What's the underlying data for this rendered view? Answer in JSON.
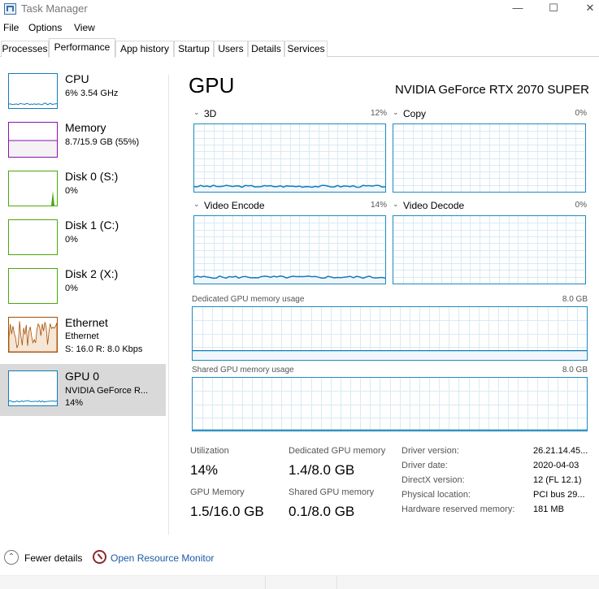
{
  "window": {
    "title": "Task Manager",
    "min_glyph": "—",
    "max_glyph": "☐",
    "close_glyph": "✕"
  },
  "menu": [
    "File",
    "Options",
    "View"
  ],
  "tabs": [
    "Processes",
    "Performance",
    "App history",
    "Startup",
    "Users",
    "Details",
    "Services"
  ],
  "active_tab": "Performance",
  "sidebar": [
    {
      "title": "CPU",
      "sub1": "6%  3.54 GHz",
      "sub2": "",
      "color": "#117dbb"
    },
    {
      "title": "Memory",
      "sub1": "8.7/15.9 GB (55%)",
      "sub2": "",
      "color": "#8b12ae"
    },
    {
      "title": "Disk 0 (S:)",
      "sub1": "0%",
      "sub2": "",
      "color": "#4da60c"
    },
    {
      "title": "Disk 1 (C:)",
      "sub1": "0%",
      "sub2": "",
      "color": "#4da60c"
    },
    {
      "title": "Disk 2 (X:)",
      "sub1": "0%",
      "sub2": "",
      "color": "#4da60c"
    },
    {
      "title": "Ethernet",
      "sub1": "Ethernet",
      "sub2": "S: 16.0  R: 8.0 Kbps",
      "color": "#a74f01"
    },
    {
      "title": "GPU 0",
      "sub1": "NVIDIA GeForce R...",
      "sub2": "14%",
      "color": "#117dbb"
    }
  ],
  "selected_item": "GPU 0",
  "gpu": {
    "title": "GPU",
    "model": "NVIDIA GeForce RTX 2070 SUPER",
    "engines": [
      {
        "name": "3D",
        "percent": "12%",
        "level": 0.12
      },
      {
        "name": "Copy",
        "percent": "0%",
        "level": 0
      },
      {
        "name": "Video Encode",
        "percent": "14%",
        "level": 0.14
      },
      {
        "name": "Video Decode",
        "percent": "0%",
        "level": 0
      }
    ],
    "chevron_glyph": "⌄",
    "dedicated_memory_usage": {
      "label": "Dedicated GPU memory usage",
      "max": "8.0 GB",
      "level": 0.175
    },
    "shared_memory_usage": {
      "label": "Shared GPU memory usage",
      "max": "8.0 GB",
      "level": 0.0125
    }
  },
  "stats": {
    "utilization": {
      "label": "Utilization",
      "value": "14%"
    },
    "dedicated_memory": {
      "label": "Dedicated GPU memory",
      "value": "1.4/8.0 GB"
    },
    "gpu_memory": {
      "label": "GPU Memory",
      "value": "1.5/16.0 GB"
    },
    "shared_memory": {
      "label": "Shared GPU memory",
      "value": "0.1/8.0 GB"
    }
  },
  "details": [
    {
      "label": "Driver version:",
      "value": "26.21.14.45..."
    },
    {
      "label": "Driver date:",
      "value": "2020-04-03"
    },
    {
      "label": "DirectX version:",
      "value": "12 (FL 12.1)"
    },
    {
      "label": "Physical location:",
      "value": "PCI bus 29..."
    },
    {
      "label": "Hardware reserved memory:",
      "value": "181 MB"
    }
  ],
  "footer": {
    "fewer_details": "Fewer details",
    "fewer_glyph": "⌃",
    "open_resource_monitor": "Open Resource Monitor"
  }
}
